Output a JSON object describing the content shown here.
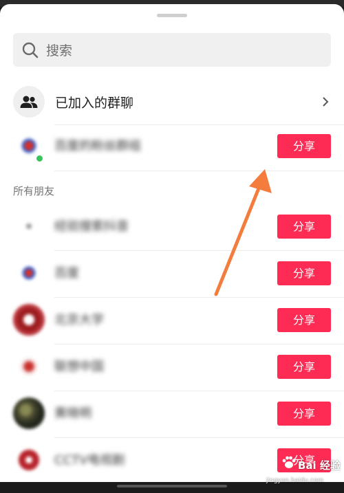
{
  "search": {
    "placeholder": "搜索"
  },
  "joined_groups": {
    "label": "已加入的群聊"
  },
  "section": {
    "all_friends": "所有朋友"
  },
  "share_label": "分享",
  "group_contacts": [
    {
      "name": "百度的粉丝群组",
      "avatar_color": "#d7302a"
    }
  ],
  "contacts": [
    {
      "name": "经验搜索抖音",
      "avatar_color": "#e6e6e6"
    },
    {
      "name": "百度",
      "avatar_color": "#d7302a"
    },
    {
      "name": "北京大学",
      "avatar_color": "#9c1b1f"
    },
    {
      "name": "联想中国",
      "avatar_color": "#c9322f"
    },
    {
      "name": "黄晓明",
      "avatar_color": "#4a4a30"
    },
    {
      "name": "CCTV电视剧",
      "avatar_color": "#b7222a"
    }
  ],
  "watermark": {
    "text": "Bai 经验",
    "sub": "jingyan.baidu.com"
  },
  "colors": {
    "accent": "#fe2c55",
    "arrow": "#f47c3c"
  }
}
